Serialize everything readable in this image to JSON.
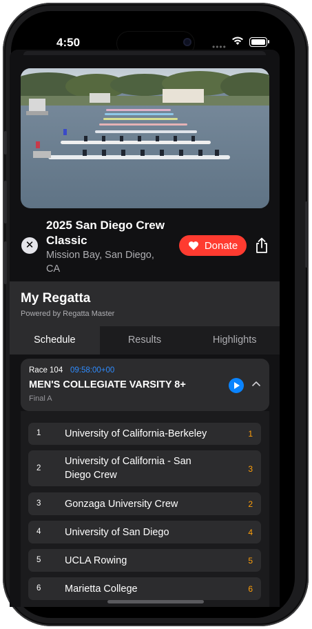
{
  "status_bar": {
    "time": "4:50",
    "dots": "••••"
  },
  "event": {
    "title": "2025 San Diego Crew Classic",
    "location": "Mission Bay, San Diego, CA",
    "donate_label": "Donate"
  },
  "regatta": {
    "title": "My Regatta",
    "subtitle": "Powered by Regatta Master"
  },
  "tabs": [
    {
      "label": "Schedule",
      "active": true
    },
    {
      "label": "Results",
      "active": false
    },
    {
      "label": "Highlights",
      "active": false
    }
  ],
  "race": {
    "number": "Race 104",
    "time": "09:58:00+00",
    "name": "MEN'S COLLEGIATE VARSITY 8+",
    "stage": "Final A"
  },
  "results": [
    {
      "place": "1",
      "name": "University of California-Berkeley",
      "lane": "1"
    },
    {
      "place": "2",
      "name": "University of California - San Diego Crew",
      "lane": "3"
    },
    {
      "place": "3",
      "name": "Gonzaga University Crew",
      "lane": "2"
    },
    {
      "place": "4",
      "name": "University of San Diego",
      "lane": "4"
    },
    {
      "place": "5",
      "name": "UCLA Rowing",
      "lane": "5"
    },
    {
      "place": "6",
      "name": "Marietta College",
      "lane": "6"
    }
  ],
  "colors": {
    "accent_blue": "#0a84ff",
    "donate_red": "#ff3b30",
    "lane_orange": "#ff9f0a"
  }
}
